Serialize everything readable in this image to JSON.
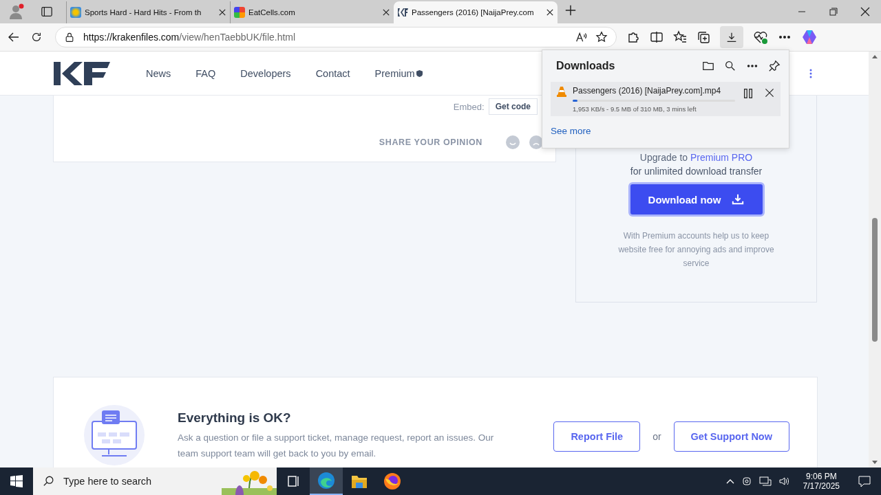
{
  "browser": {
    "tabs": [
      {
        "title": "Sports Hard - Hard Hits - From th",
        "selected": false
      },
      {
        "title": "EatCells.com",
        "selected": false
      },
      {
        "title": "Passengers (2016) [NaijaPrey.com",
        "selected": true
      }
    ],
    "url": {
      "host": "https://krakenfiles.com",
      "path": "/view/henTaebbUK/file.html"
    }
  },
  "site": {
    "nav": [
      "News",
      "FAQ",
      "Developers",
      "Contact",
      "Premium"
    ],
    "file_card": {
      "embed_label": "Embed:",
      "embed_button": "Get code",
      "opinion": "SHARE YOUR OPINION"
    },
    "download_card": {
      "upgrade": "Upgrade to",
      "upgrade_link": "Premium PRO",
      "subtitle": "for unlimited download transfer",
      "button": "Download now",
      "note": "With Premium accounts help us to keep website free for annoying ads and improve service"
    },
    "support": {
      "title": "Everything is OK?",
      "text": "Ask a question or file a support ticket, manage request, report an issues. Our team support team will get back to you by email.",
      "report_button": "Report File",
      "or": "or",
      "support_button": "Get Support Now"
    }
  },
  "downloads_panel": {
    "title": "Downloads",
    "items": [
      {
        "name": "Passengers (2016) [NaijaPrey.com].mp4",
        "level": 0.03,
        "status": "1,953 KB/s - 9.5 MB of 310 MB, 3 mins left"
      }
    ],
    "see_more": "See more"
  },
  "taskbar": {
    "search_placeholder": "Type here to search",
    "apps": [
      {
        "kind": "taskview",
        "selected": false
      },
      {
        "kind": "edge",
        "selected": true
      },
      {
        "kind": "explorer",
        "selected": false
      },
      {
        "kind": "firefox",
        "selected": false
      }
    ],
    "time": "9:06 PM",
    "date": "7/17/2025"
  }
}
